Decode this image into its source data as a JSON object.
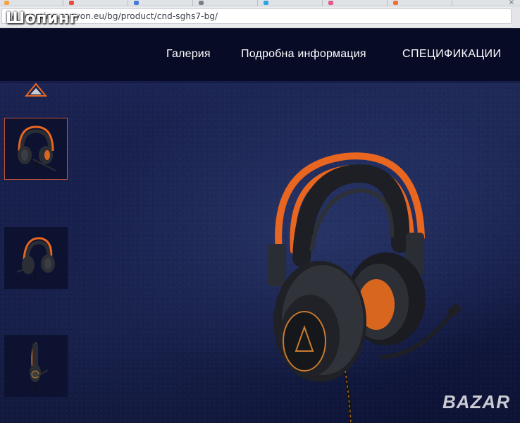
{
  "browser": {
    "url": "gaming.canyon.eu/bg/product/cnd-sghs7-bg/",
    "overlay_title": "Шопинг"
  },
  "nav": {
    "items": [
      {
        "label": "Галерия"
      },
      {
        "label": "Подробна информация"
      },
      {
        "label": "СПЕЦИФИКАЦИИ"
      }
    ]
  },
  "gallery": {
    "thumbnails": [
      {
        "view": "front",
        "active": true
      },
      {
        "view": "side",
        "active": false
      },
      {
        "view": "profile",
        "active": false
      }
    ]
  },
  "watermark": "BAZAR",
  "colors": {
    "nav_bg": "#080b26",
    "accent_orange": "#e8661f",
    "thumb_border": "#c2543a"
  }
}
